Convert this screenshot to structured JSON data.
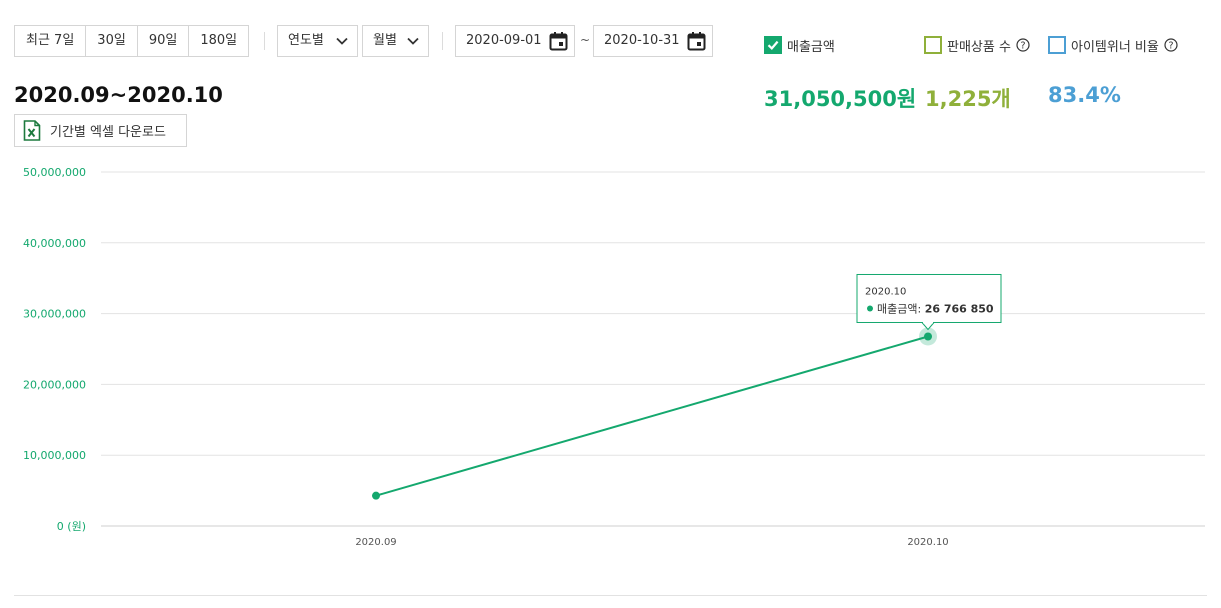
{
  "period_buttons": [
    "최근 7일",
    "30일",
    "90일",
    "180일"
  ],
  "year_select": "연도별",
  "month_select": "월별",
  "date_from": "2020-09-01",
  "date_separator": "~",
  "date_to": "2020-10-31",
  "legend": {
    "sales": {
      "label": "매출금액",
      "checked": true,
      "color": "#14a86e",
      "total": "31,050,500원"
    },
    "products": {
      "label": "판매상품 수",
      "checked": false,
      "color": "#8fb03a",
      "total": "1,225개"
    },
    "item_winner": {
      "label": "아이템위너 비율",
      "checked": false,
      "color": "#4c9fd4",
      "total": "83.4%"
    }
  },
  "period_title": "2020.09~2020.10",
  "excel_button": "기간별 엑셀 다운로드",
  "chart_data": {
    "type": "line",
    "categories": [
      "2020.09",
      "2020.10"
    ],
    "series": [
      {
        "name": "매출금액",
        "values": [
          4283650,
          26766850
        ],
        "color": "#14a86e"
      }
    ],
    "ylim": [
      0,
      50000000
    ],
    "yticks": [
      "0 (원)",
      "10,000,000",
      "20,000,000",
      "30,000,000",
      "40,000,000",
      "50,000,000"
    ],
    "grid": true,
    "tooltip": {
      "title": "2020.10",
      "label": "매출금액: ",
      "value": "26 766 850",
      "index": 1
    }
  }
}
